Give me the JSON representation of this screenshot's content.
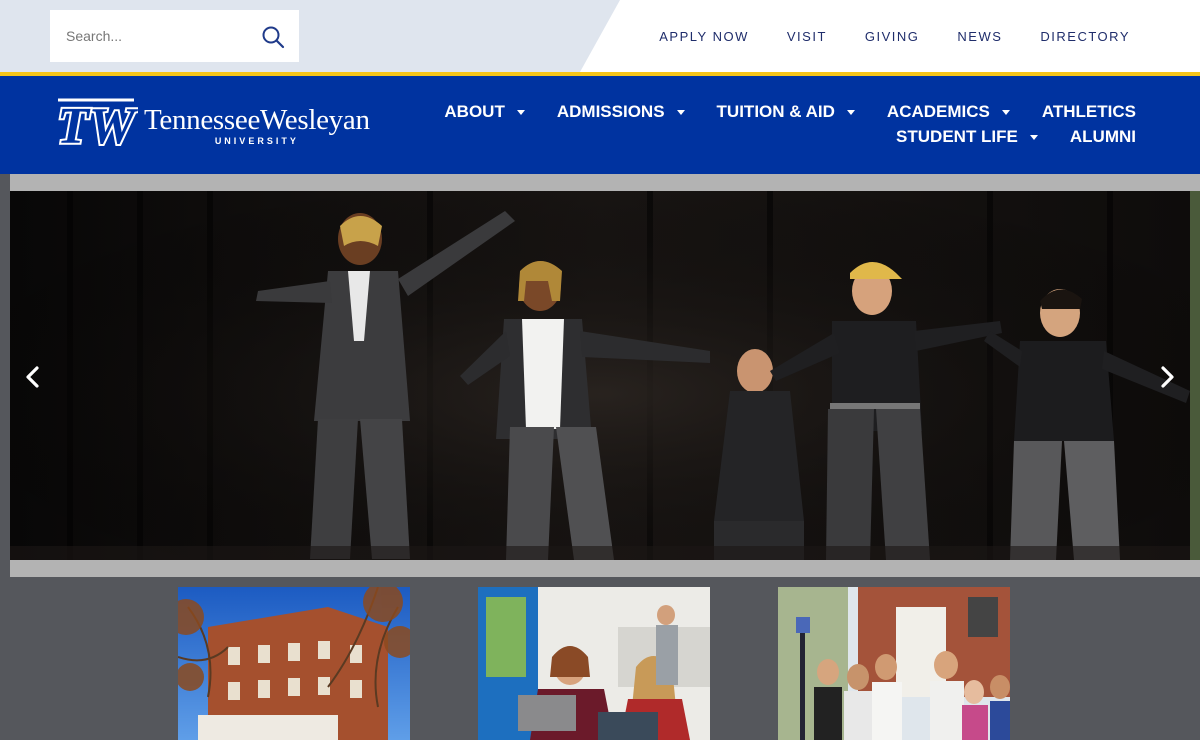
{
  "search": {
    "placeholder": "Search..."
  },
  "utility_nav": {
    "items": [
      {
        "label": "APPLY NOW"
      },
      {
        "label": "VISIT"
      },
      {
        "label": "GIVING"
      },
      {
        "label": "NEWS"
      },
      {
        "label": "DIRECTORY"
      }
    ]
  },
  "brand": {
    "monogram": "TW",
    "name": "TennesseeWesleyan",
    "sub": "UNIVERSITY",
    "primary_color": "#0033a0",
    "accent_color": "#f5c518"
  },
  "main_nav": {
    "row1": [
      {
        "label": "ABOUT",
        "dropdown": true
      },
      {
        "label": "ADMISSIONS",
        "dropdown": true
      },
      {
        "label": "TUITION & AID",
        "dropdown": true
      },
      {
        "label": "ACADEMICS",
        "dropdown": true
      },
      {
        "label": "ATHLETICS",
        "dropdown": false
      }
    ],
    "row2": [
      {
        "label": "STUDENT LIFE",
        "dropdown": true
      },
      {
        "label": "ALUMNI",
        "dropdown": false
      }
    ]
  },
  "hero": {
    "prev_icon": "chevron-left-icon",
    "next_icon": "chevron-right-icon"
  },
  "cards": [
    {
      "icon": "campus-building-photo"
    },
    {
      "icon": "students-classroom-photo"
    },
    {
      "icon": "students-outdoors-photo"
    }
  ]
}
